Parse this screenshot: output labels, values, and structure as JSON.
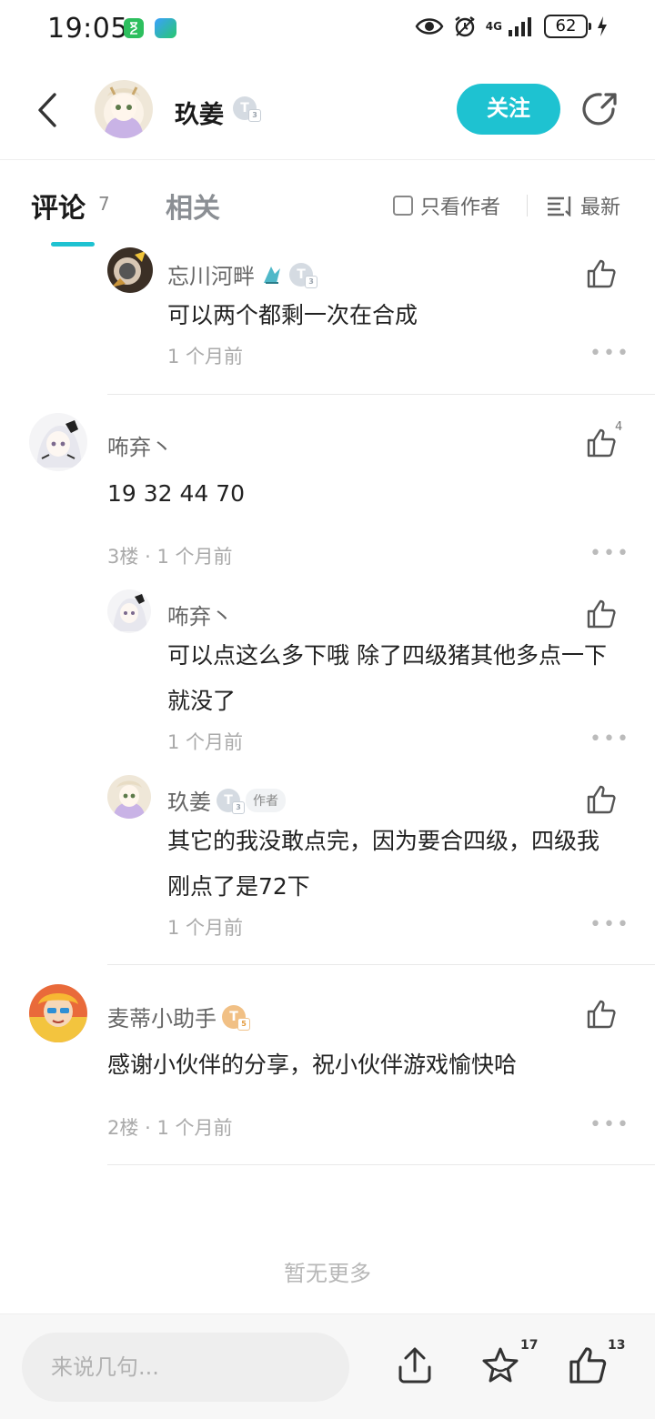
{
  "status_bar": {
    "time": "19:05",
    "network": "4G",
    "battery": "62"
  },
  "header": {
    "user_name": "玖姜",
    "level": "3",
    "follow_label": "关注"
  },
  "tabs": {
    "comments_label": "评论",
    "comments_count": "7",
    "related_label": "相关",
    "only_author_label": "只看作者",
    "sort_label": "最新"
  },
  "comments": [
    {
      "name": "忘川河畔",
      "level": "3",
      "text": "可以两个都剩一次在合成",
      "time": "1 个月前"
    },
    {
      "name": "咘弃丶",
      "text": "19 32 44 70",
      "floor": "3楼",
      "time": "1 个月前",
      "likes": "4"
    },
    {
      "name": "咘弃丶",
      "text": "可以点这么多下哦 除了四级猪其他多点一下就没了",
      "time": "1 个月前"
    },
    {
      "name": "玖姜",
      "level": "3",
      "author_tag": "作者",
      "text": "其它的我没敢点完，因为要合四级，四级我刚点了是72下",
      "time": "1 个月前"
    },
    {
      "name": "麦蒂小助手",
      "level": "5",
      "text": "感谢小伙伴的分享，祝小伙伴游戏愉快哈",
      "floor": "2楼",
      "time": "1 个月前"
    }
  ],
  "meta_separator": "·",
  "no_more_label": "暂无更多",
  "bottom_bar": {
    "input_placeholder": "来说几句...",
    "favorite_count": "17",
    "like_count": "13"
  },
  "colors": {
    "accent": "#1ec2d1",
    "text_primary": "#222222",
    "text_secondary": "#888888"
  }
}
